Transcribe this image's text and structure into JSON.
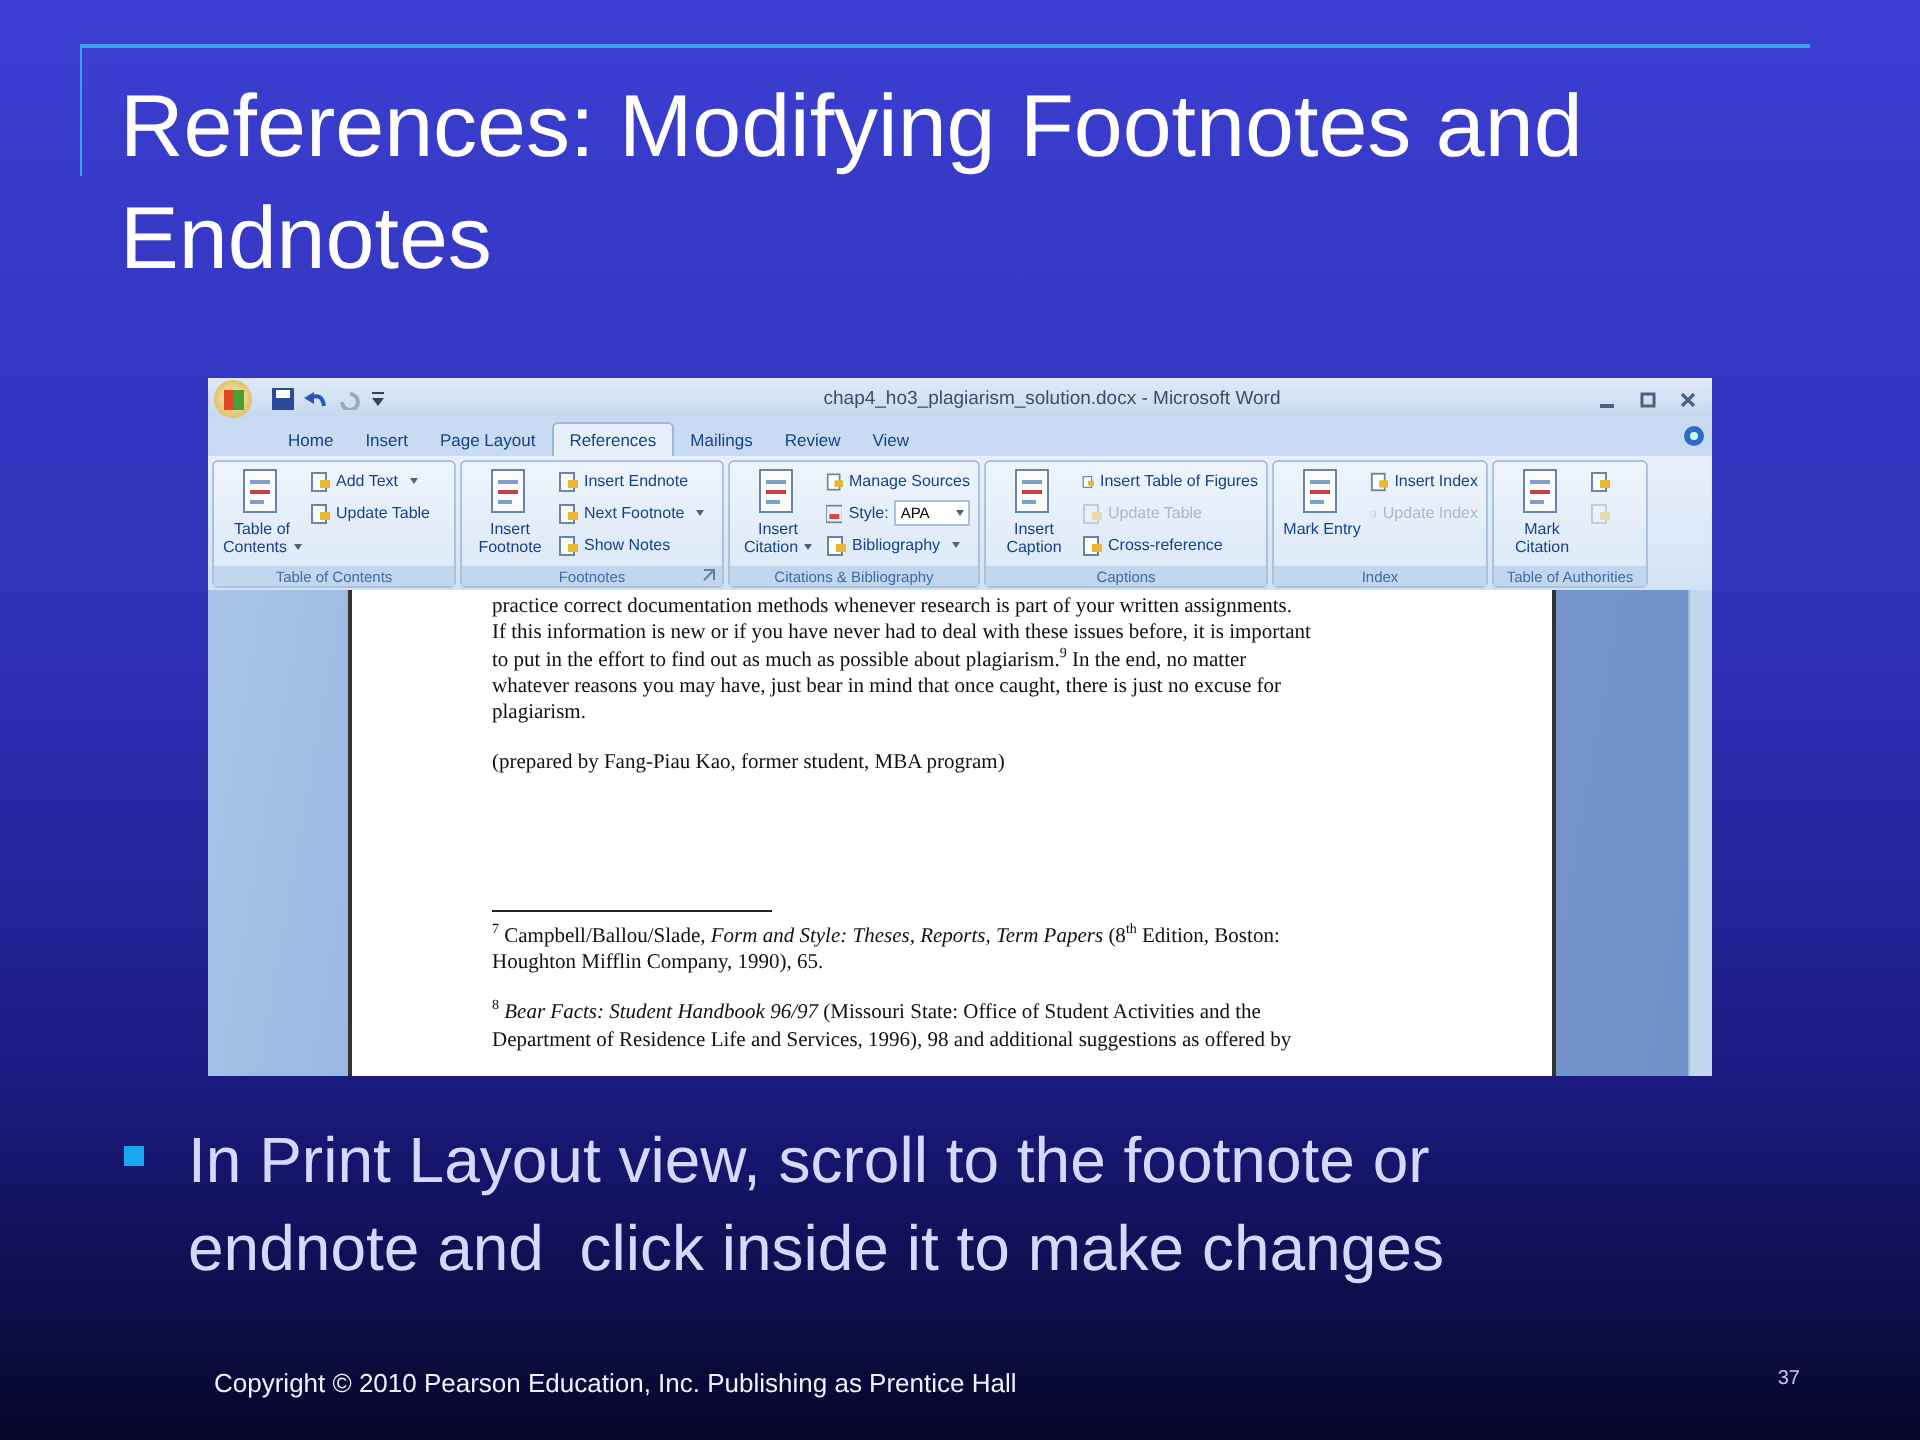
{
  "slide": {
    "title": "References: Modifying Footnotes and Endnotes"
  },
  "word_window": {
    "title": "chap4_ho3_plagiarism_solution.docx - Microsoft Word",
    "tabs": [
      {
        "label": "Home",
        "selected": false
      },
      {
        "label": "Insert",
        "selected": false
      },
      {
        "label": "Page Layout",
        "selected": false
      },
      {
        "label": "References",
        "selected": true
      },
      {
        "label": "Mailings",
        "selected": false
      },
      {
        "label": "Review",
        "selected": false
      },
      {
        "label": "View",
        "selected": false
      }
    ],
    "groups": [
      {
        "name": "Table of Contents",
        "launcher": false,
        "large": {
          "label": "Table of Contents",
          "dropdown": true
        },
        "small": [
          {
            "label": "Add Text",
            "dropdown": true,
            "disabled": false
          },
          {
            "label": "Update Table",
            "dropdown": false,
            "disabled": false
          }
        ]
      },
      {
        "name": "Footnotes",
        "launcher": true,
        "large": {
          "label": "Insert Footnote",
          "dropdown": false
        },
        "small": [
          {
            "label": "Insert Endnote",
            "dropdown": false,
            "disabled": false
          },
          {
            "label": "Next Footnote",
            "dropdown": true,
            "disabled": false
          },
          {
            "label": "Show Notes",
            "dropdown": false,
            "disabled": false
          }
        ]
      },
      {
        "name": "Citations & Bibliography",
        "launcher": false,
        "large": {
          "label": "Insert Citation",
          "dropdown": true
        },
        "small": [
          {
            "label": "Manage Sources",
            "dropdown": false,
            "disabled": false
          },
          {
            "label": "Style:",
            "kind": "style",
            "value": "APA"
          },
          {
            "label": "Bibliography",
            "dropdown": true,
            "disabled": false
          }
        ]
      },
      {
        "name": "Captions",
        "launcher": false,
        "large": {
          "label": "Insert Caption",
          "dropdown": false
        },
        "small": [
          {
            "label": "Insert Table of Figures",
            "dropdown": false,
            "disabled": false
          },
          {
            "label": "Update Table",
            "dropdown": false,
            "disabled": true
          },
          {
            "label": "Cross-reference",
            "dropdown": false,
            "disabled": false
          }
        ]
      },
      {
        "name": "Index",
        "launcher": false,
        "large": {
          "label": "Mark Entry",
          "dropdown": false
        },
        "small": [
          {
            "label": "Insert Index",
            "dropdown": false,
            "disabled": false
          },
          {
            "label": "Update Index",
            "dropdown": false,
            "disabled": true
          }
        ]
      },
      {
        "name": "Table of Authorities",
        "launcher": false,
        "large": {
          "label": "Mark Citation",
          "dropdown": false
        },
        "small": [
          {
            "disabled": false
          },
          {
            "disabled": true
          }
        ]
      }
    ],
    "document": {
      "paragraphs": [
        {
          "kind": "body",
          "lines": [
            "practice correct documentation methods whenever research is part of your written assignments.",
            "If this information is new or if you have never had to deal with these issues before, it is important",
            "to put in the effort to find out as much as possible about plagiarism.$^{9}$   In the end, no matter",
            "whatever reasons you may have, just bear in mind that once caught, there is just no excuse for",
            "plagiarism."
          ]
        },
        {
          "kind": "body",
          "lines": [
            "(prepared by Fang-Piau Kao, former student, MBA program)"
          ]
        },
        {
          "kind": "footnote",
          "lines": [
            "$^{7}$ Campbell/Ballou/Slade, *Form and Style: Theses, Reports, Term Papers* (8$^{th}$ Edition, Boston:",
            "Houghton Mifflin Company, 1990), 65."
          ]
        },
        {
          "kind": "footnote",
          "lines": [
            "$^{8}$ *Bear Facts: Student Handbook 96/97* (Missouri  State: Office of Student Activities and the",
            "Department of Residence Life and Services, 1996), 98 and additional suggestions as offered by"
          ]
        }
      ]
    }
  },
  "bullets": [
    "In Print Layout view, scroll to the footnote or endnote and  click inside it to make changes"
  ],
  "footer": {
    "copyright": "Copyright © 2010 Pearson Education, Inc.  Publishing as Prentice Hall",
    "page_number": "37"
  }
}
